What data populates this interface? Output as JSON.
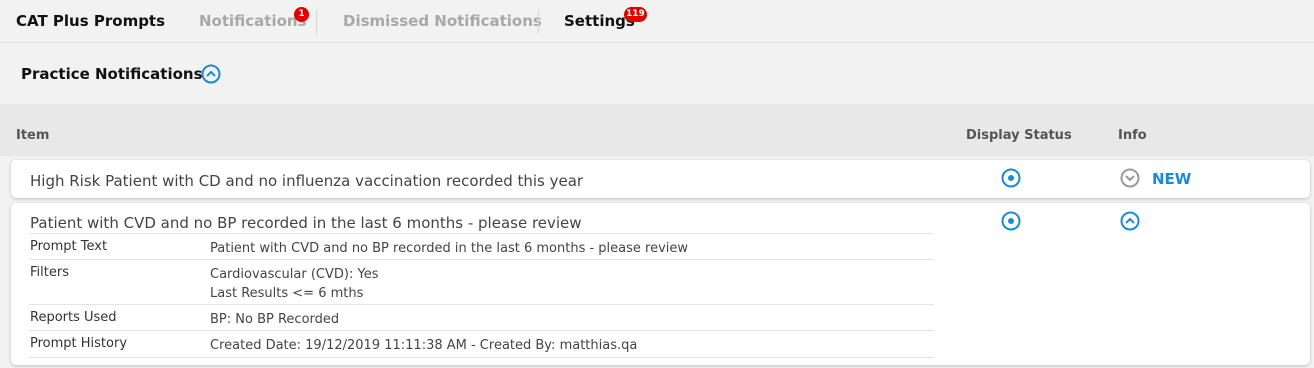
{
  "nav": {
    "app_title": "CAT Plus Prompts",
    "tabs": [
      {
        "label": "Notifications",
        "badge": "1"
      },
      {
        "label": "Dismissed Notifications"
      },
      {
        "label": "Settings",
        "badge": "119"
      }
    ]
  },
  "section": {
    "title": "Practice Notifications"
  },
  "table": {
    "headers": {
      "item": "Item",
      "display_status": "Display Status",
      "info": "Info"
    },
    "rows": [
      {
        "title": "High Risk Patient with CD and no influenza vaccination recorded this year",
        "new_label": "NEW",
        "expanded": false
      },
      {
        "title": "Patient with CVD and no BP recorded in the last 6 months - please review",
        "expanded": true,
        "details": [
          {
            "label": "Prompt Text",
            "value": "Patient with CVD and no BP recorded in the last 6 months - please review"
          },
          {
            "label": "Filters",
            "values": [
              "Cardiovascular (CVD): Yes",
              "Last Results <= 6 mths"
            ]
          },
          {
            "label": "Reports Used",
            "value": "BP: No BP Recorded"
          },
          {
            "label": "Prompt History",
            "value": "Created Date: 19/12/2019 11:11:38 AM - Created By: matthias.qa"
          }
        ]
      }
    ]
  },
  "colors": {
    "accent": "#1a8ad6",
    "badge": "#e00000",
    "collapsed_icon": "#9a9a9a"
  },
  "icons": {
    "collapse_section": "chevron-up-circle-icon",
    "display_status": "radio-dot-icon",
    "expand": "chevron-down-circle-icon",
    "collapse": "chevron-up-circle-icon"
  }
}
